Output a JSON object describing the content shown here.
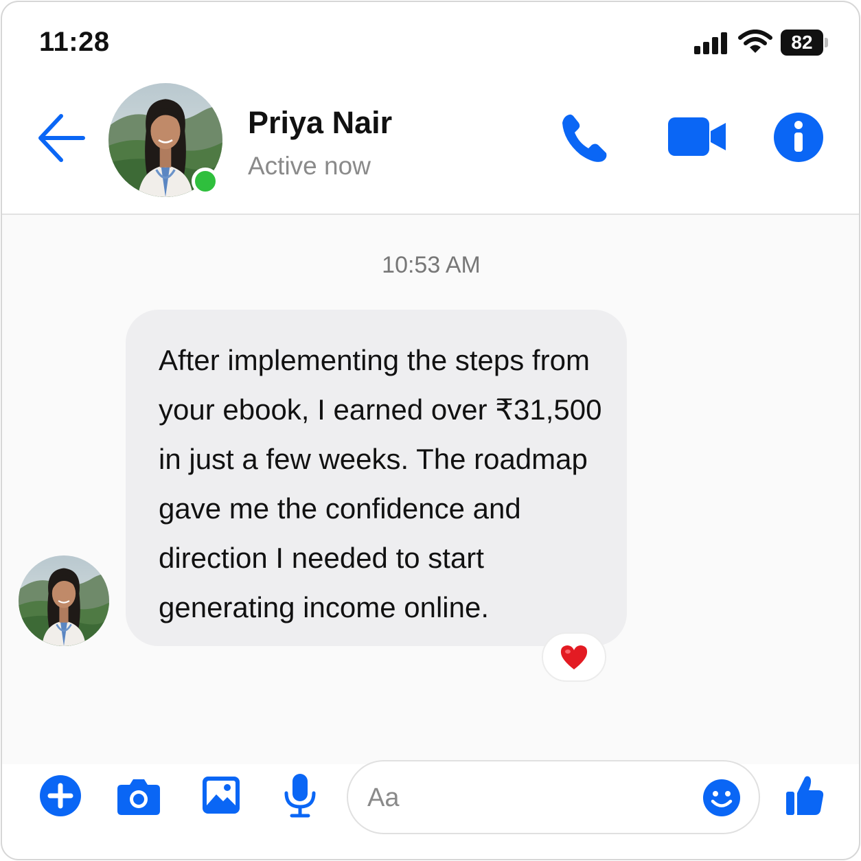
{
  "status_bar": {
    "time": "11:28",
    "battery_level": "82",
    "icons": [
      "signal-icon",
      "wifi-icon",
      "battery-icon"
    ]
  },
  "header": {
    "contact_name": "Priya Nair",
    "contact_status": "Active now",
    "online": true,
    "icons": [
      "back-arrow-icon",
      "phone-icon",
      "video-camera-icon",
      "info-icon"
    ]
  },
  "conversation": {
    "timestamp": "10:53 AM",
    "messages": [
      {
        "sender": "Priya Nair",
        "text": "After implementing the steps from your ebook, I earned over ₹31,500 in just a few weeks. The roadmap gave me the confidence and direction I needed to start generating income online.",
        "reaction": "❤️"
      }
    ]
  },
  "composer": {
    "placeholder": "Aa",
    "value": "",
    "icons": [
      "plus-icon",
      "camera-icon",
      "gallery-icon",
      "microphone-icon",
      "emoji-icon",
      "thumbs-up-icon"
    ]
  },
  "colors": {
    "accent": "#0a66f5",
    "online_green": "#2fbf3d",
    "bubble_bg": "#eeeef0",
    "muted_text": "#8a8a8a"
  }
}
